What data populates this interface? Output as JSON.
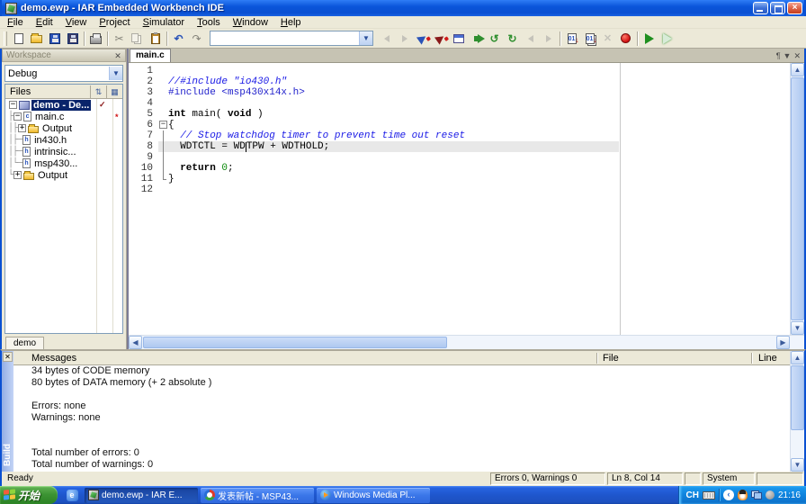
{
  "window": {
    "title": "demo.ewp - IAR Embedded Workbench IDE"
  },
  "menu": {
    "items": [
      "File",
      "Edit",
      "View",
      "Project",
      "Simulator",
      "Tools",
      "Window",
      "Help"
    ]
  },
  "toolbar": {
    "find_value": ""
  },
  "workspace": {
    "title": "Workspace",
    "config": "Debug",
    "files_header": "Files",
    "tab": "demo",
    "tree": [
      {
        "prefix": "",
        "box": "-",
        "icon": "project",
        "label": "demo - De...",
        "selected": true,
        "check": "✓"
      },
      {
        "prefix": "├",
        "box": "-",
        "icon": "cfile",
        "label": "main.c",
        "mark": "*"
      },
      {
        "prefix": "│├",
        "box": "+",
        "icon": "folder",
        "label": "Output"
      },
      {
        "prefix": "│├─",
        "icon": "hfile",
        "label": "in430.h"
      },
      {
        "prefix": "│├─",
        "icon": "hfile",
        "label": "intrinsic..."
      },
      {
        "prefix": "│└─",
        "icon": "hfile",
        "label": "msp430..."
      },
      {
        "prefix": "└",
        "box": "+",
        "icon": "folder",
        "label": "Output"
      }
    ]
  },
  "editor": {
    "tab": "main.c",
    "lines": [
      {
        "n": "1",
        "segs": []
      },
      {
        "n": "2",
        "segs": [
          {
            "t": "//#include \"io430.h\"",
            "c": "comment"
          }
        ]
      },
      {
        "n": "3",
        "segs": [
          {
            "t": "#include <msp430x14x.h>",
            "c": "preproc"
          }
        ]
      },
      {
        "n": "4",
        "segs": []
      },
      {
        "n": "5",
        "segs": [
          {
            "t": "int",
            "c": "kw"
          },
          {
            "t": " main( "
          },
          {
            "t": "void",
            "c": "kw"
          },
          {
            "t": " )"
          }
        ]
      },
      {
        "n": "6",
        "fold": "start",
        "segs": [
          {
            "t": "{"
          }
        ]
      },
      {
        "n": "7",
        "fold": "mid",
        "segs": [
          {
            "t": "  "
          },
          {
            "t": "// Stop watchdog timer to prevent time out reset",
            "c": "comment"
          }
        ]
      },
      {
        "n": "8",
        "fold": "mid",
        "current": true,
        "segs": [
          {
            "t": "  WDTCTL = WD"
          },
          {
            "caret": true
          },
          {
            "t": "TPW + WDTHOLD;"
          }
        ]
      },
      {
        "n": "9",
        "fold": "mid",
        "segs": []
      },
      {
        "n": "10",
        "fold": "mid",
        "segs": [
          {
            "t": "  "
          },
          {
            "t": "return",
            "c": "kw"
          },
          {
            "t": " "
          },
          {
            "t": "0",
            "c": "num"
          },
          {
            "t": ";"
          }
        ]
      },
      {
        "n": "11",
        "fold": "end",
        "segs": [
          {
            "t": "}"
          }
        ]
      },
      {
        "n": "12",
        "segs": []
      }
    ]
  },
  "messages": {
    "pane_tab": "Build",
    "columns": [
      "Messages",
      "File",
      "Line"
    ],
    "rows": [
      "34 bytes of CODE memory",
      "80 bytes of DATA memory (+ 2 absolute )",
      "",
      "Errors: none",
      "Warnings: none",
      "",
      "",
      "Total number of errors: 0",
      "Total number of warnings: 0"
    ]
  },
  "status": {
    "ready": "Ready",
    "errors": "Errors 0, Warnings 0",
    "position": "Ln 8, Col 14",
    "system": "System"
  },
  "taskbar": {
    "start": "开始",
    "tasks": [
      {
        "label": "demo.ewp - IAR E...",
        "icon": "iar",
        "active": true
      },
      {
        "label": "发表新帖 - MSP43...",
        "icon": "browser",
        "active": false
      },
      {
        "label": "Windows Media Pl...",
        "icon": "wmp",
        "active": false
      }
    ],
    "tray": {
      "lang": "CH",
      "time": "21:16"
    }
  }
}
